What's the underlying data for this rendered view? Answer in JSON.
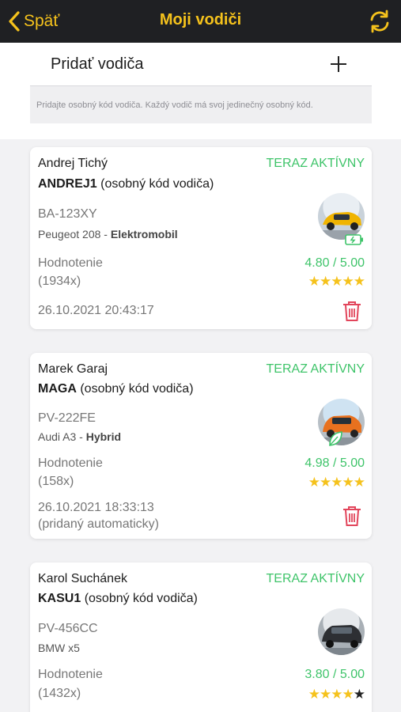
{
  "header": {
    "back_label": "Späť",
    "title": "Moji vodiči"
  },
  "add_driver": {
    "label": "Pridať vodiča",
    "hint": "Pridajte osobný kód vodiča. Každý vodič má svoj jedinečný osobný kód."
  },
  "drivers": [
    {
      "name": "Andrej Tichý",
      "code": "ANDREJ1",
      "code_suffix": "(osobný kód vodiča)",
      "status": "TERAZ AKTÍVNY",
      "plate": "BA-123XY",
      "car": "Peugeot 208 - ",
      "car_type": "Elektromobil",
      "rating_label": "Hodnotenie",
      "rating_count": "(1934x)",
      "score": "4.80 / 5.00",
      "stars": "★★★★★",
      "date": "26.10.2021 20:43:17",
      "photo_color": "#f0b400",
      "badge_icon": "battery-icon"
    },
    {
      "name": "Marek Garaj",
      "code": "MAGA",
      "code_suffix": "(osobný kód vodiča)",
      "status": "TERAZ AKTÍVNY",
      "plate": "PV-222FE",
      "car": "Audi A3 - ",
      "car_type": "Hybrid",
      "rating_label": "Hodnotenie",
      "rating_count": "(158x)",
      "score": "4.98 / 5.00",
      "stars": "★★★★★",
      "date": "26.10.2021 18:33:13",
      "date_note": "(pridaný automaticky)",
      "photo_color": "#e8711f",
      "badge_icon": "leaf-icon"
    },
    {
      "name": "Karol Suchánek",
      "code": "KASU1",
      "code_suffix": "(osobný kód vodiča)",
      "status": "TERAZ AKTÍVNY",
      "plate": "PV-456CC",
      "car": "BMW x5",
      "rating_label": "Hodnotenie",
      "rating_count": "(1432x)",
      "score": "3.80 / 5.00",
      "stars_on": "★★★★",
      "stars_off": "★",
      "photo_color": "#2d2f33"
    }
  ],
  "colors": {
    "accent": "#f5c21c",
    "active": "#3fc46a",
    "delete": "#e2455b",
    "topbar": "#1f2023"
  }
}
